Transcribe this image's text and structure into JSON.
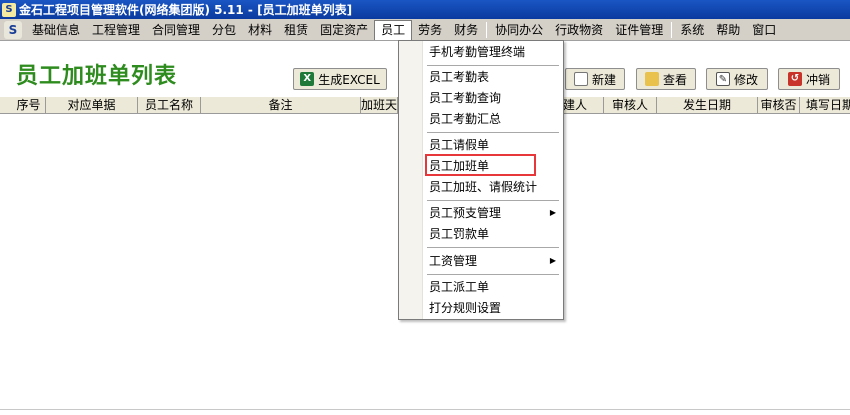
{
  "window": {
    "title": "金石工程项目管理软件(网络集团版) 5.11 - [员工加班单列表]",
    "app_icon": "S"
  },
  "menubar": {
    "icon": "S",
    "items": [
      "基础信息",
      "工程管理",
      "合同管理",
      "分包",
      "材料",
      "租赁",
      "固定资产",
      "员工",
      "劳务",
      "财务",
      "协同办公",
      "行政物资",
      "证件管理",
      "系统",
      "帮助",
      "窗口"
    ],
    "active": "员工"
  },
  "page": {
    "title": "员工加班单列表"
  },
  "toolbar": {
    "excel_label": "生成EXCEL",
    "new_label": "新建",
    "view_label": "查看",
    "edit_label": "修改",
    "reverse_label": "冲销"
  },
  "table": {
    "columns": [
      "序号",
      "对应单据",
      "员工名称",
      "备注",
      "加班天",
      "建人",
      "审核人",
      "发生日期",
      "审核否",
      "填写日期"
    ]
  },
  "dropdown": {
    "items": [
      "手机考勤管理终端",
      "员工考勤表",
      "员工考勤查询",
      "员工考勤汇总",
      "员工请假单",
      "员工加班单",
      "员工加班、请假统计",
      "员工预支管理",
      "员工罚款单",
      "工资管理",
      "员工派工单",
      "打分规则设置"
    ],
    "highlighted": "员工加班单",
    "submenu_arrow": "▶"
  },
  "colors": {
    "title_green": "#2e8b1e",
    "highlight_red": "#e8373a",
    "titlebar_blue": "#0a3a9e"
  }
}
